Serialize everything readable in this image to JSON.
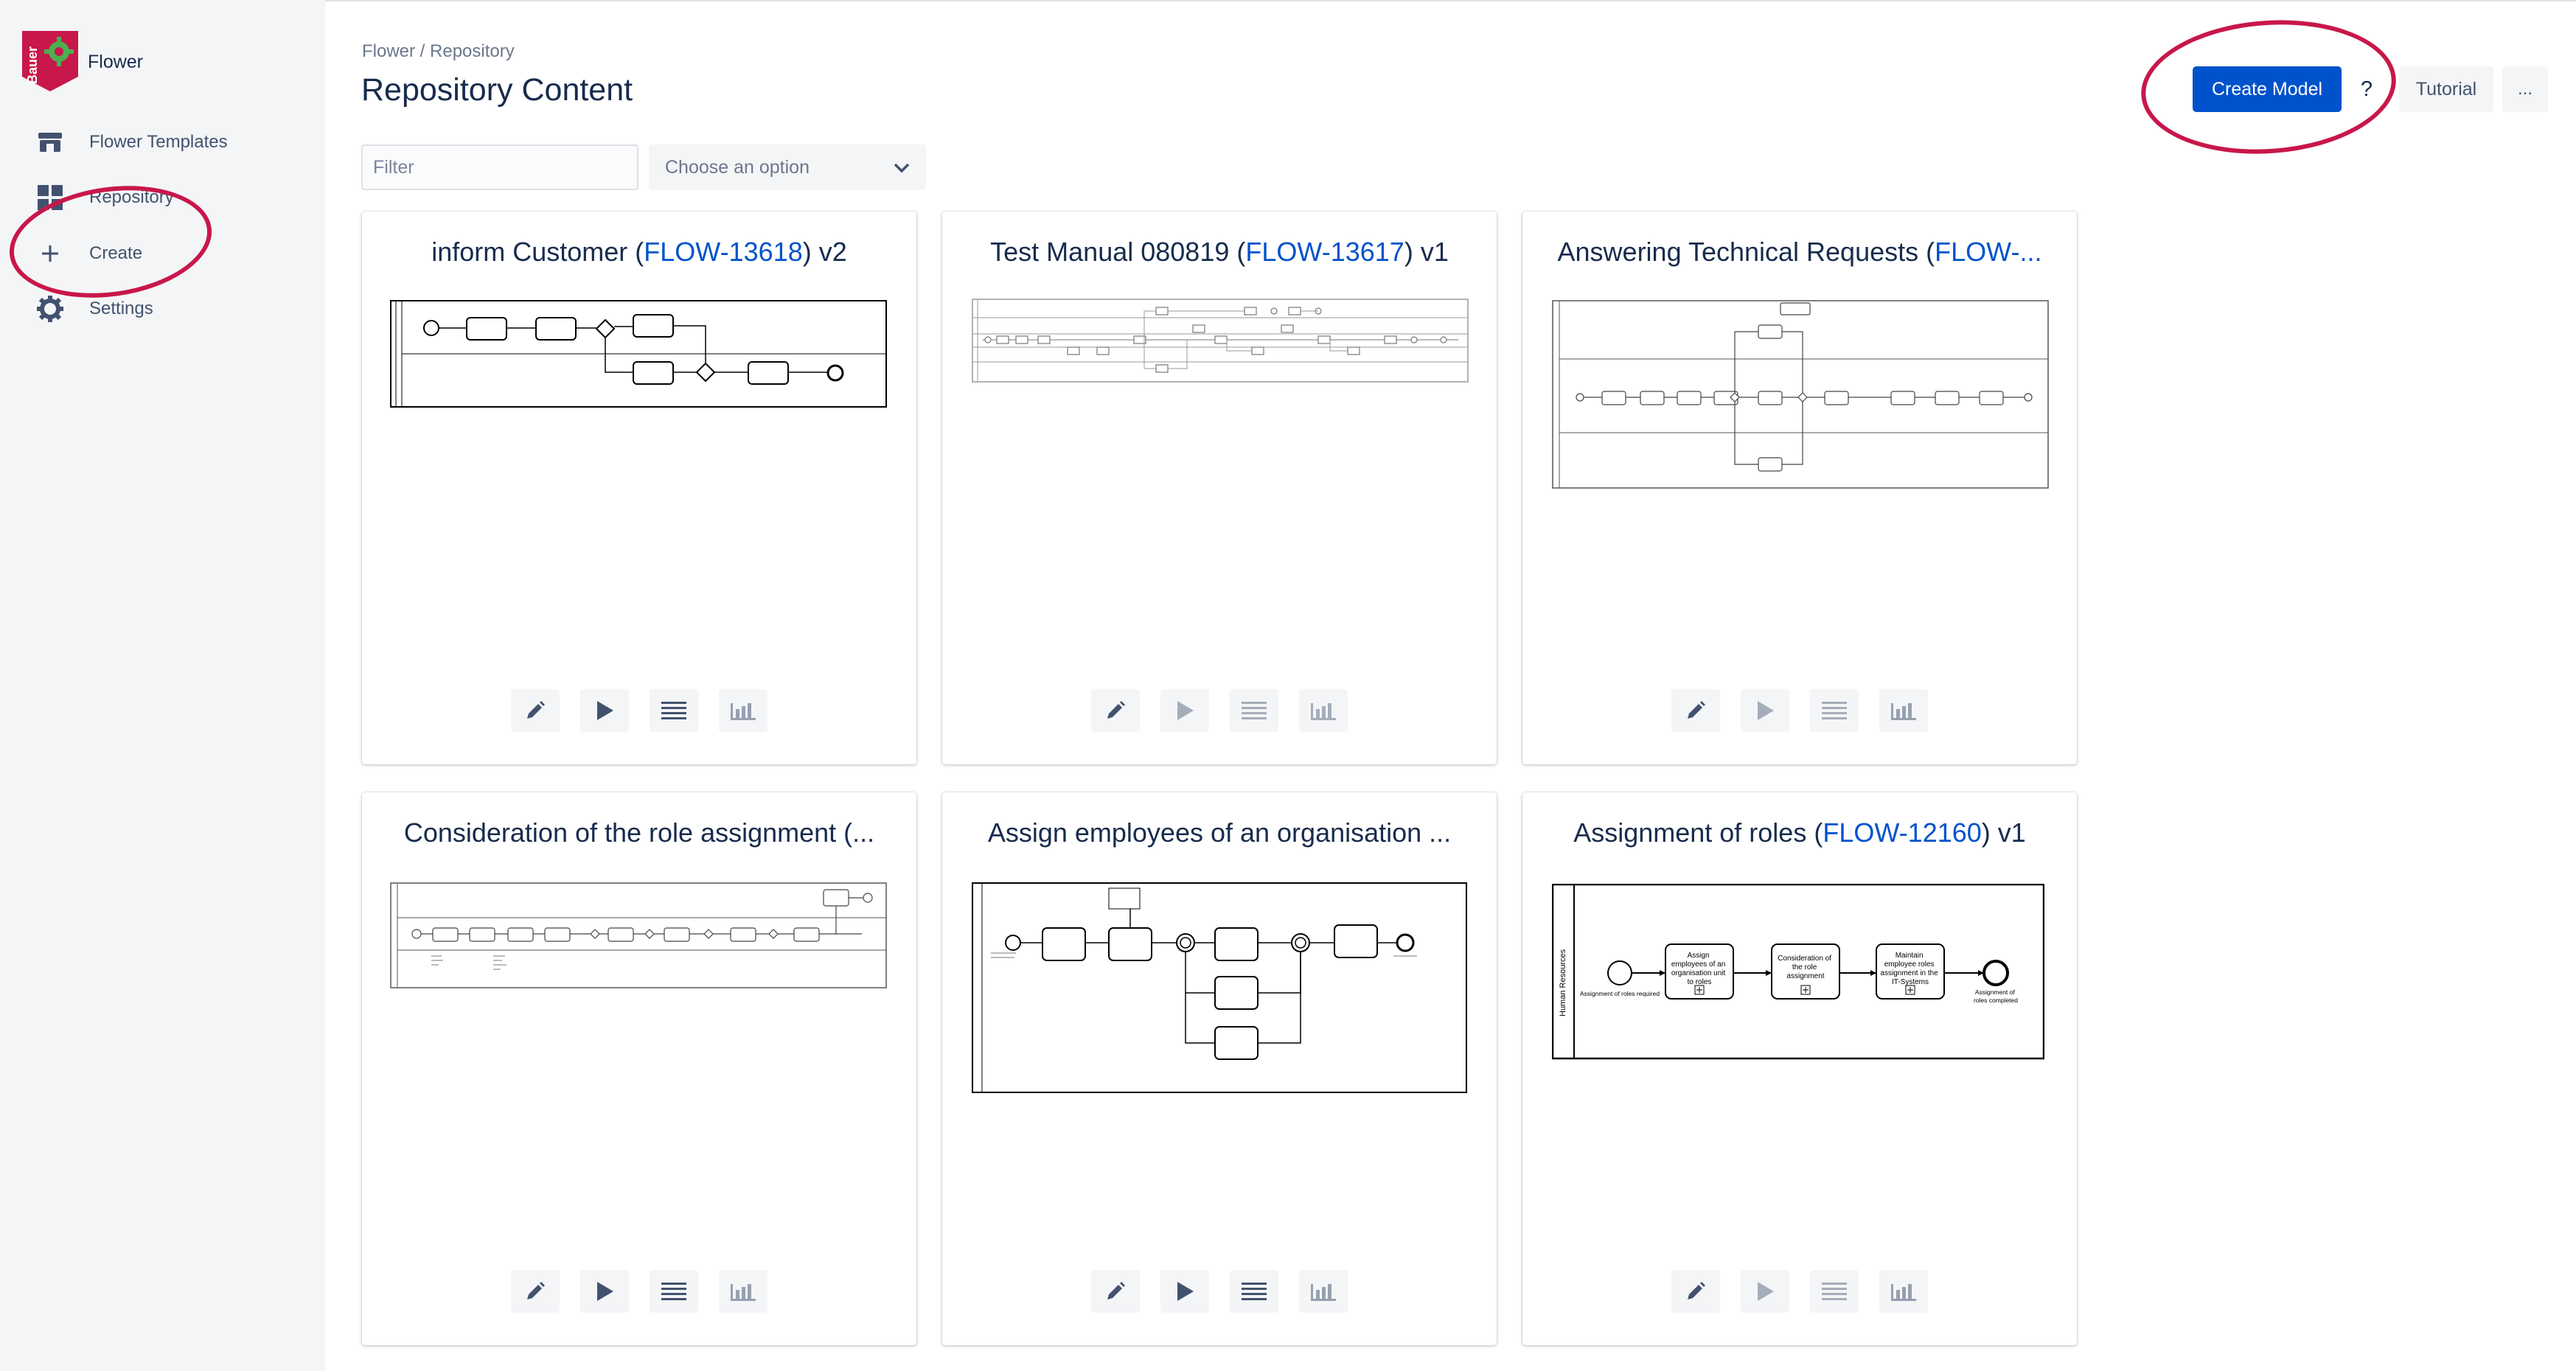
{
  "app": {
    "name": "Flower",
    "logo_text": "Bauer"
  },
  "sidebar": {
    "items": [
      {
        "label": "Flower Templates"
      },
      {
        "label": "Repository"
      },
      {
        "label": "Create"
      },
      {
        "label": "Settings"
      }
    ]
  },
  "header": {
    "breadcrumb": "Flower / Repository",
    "title": "Repository Content",
    "create_label": "Create Model",
    "help_label": "?",
    "tutorial_label": "Tutorial",
    "more_label": "..."
  },
  "filters": {
    "filter_placeholder": "Filter",
    "select_value": "Choose an option"
  },
  "colors": {
    "primary": "#0052cc",
    "annotation": "#c8174a"
  },
  "cards": [
    {
      "name": "inform Customer",
      "open": " (",
      "key": "FLOW-13618",
      "close": ")",
      "version": " v2"
    },
    {
      "name": "Test Manual 080819",
      "open": " (",
      "key": "FLOW-13617",
      "close": ")",
      "version": " v1"
    },
    {
      "name": "Answering Technical Requests",
      "open": " (",
      "key": "FLOW-...",
      "close": "",
      "version": ""
    },
    {
      "name": "Consideration of the role assignment (...",
      "open": "",
      "key": "",
      "close": "",
      "version": ""
    },
    {
      "name": "Assign employees of an organisation ...",
      "open": "",
      "key": "",
      "close": "",
      "version": ""
    },
    {
      "name": "Assignment of roles",
      "open": " (",
      "key": "FLOW-12160",
      "close": ")",
      "version": " v1"
    }
  ],
  "diagram6": {
    "lane": "Human Resources",
    "start": "Assignment of roles required",
    "task1": [
      "Assign",
      "employees of an",
      "organisation unit",
      "to roles"
    ],
    "task2": [
      "Consideration of",
      "the role",
      "assignment"
    ],
    "task3": [
      "Maintain",
      "employee roles",
      "assignment in the",
      "IT-Systems"
    ],
    "end": [
      "Assignment of",
      "roles completed"
    ]
  }
}
